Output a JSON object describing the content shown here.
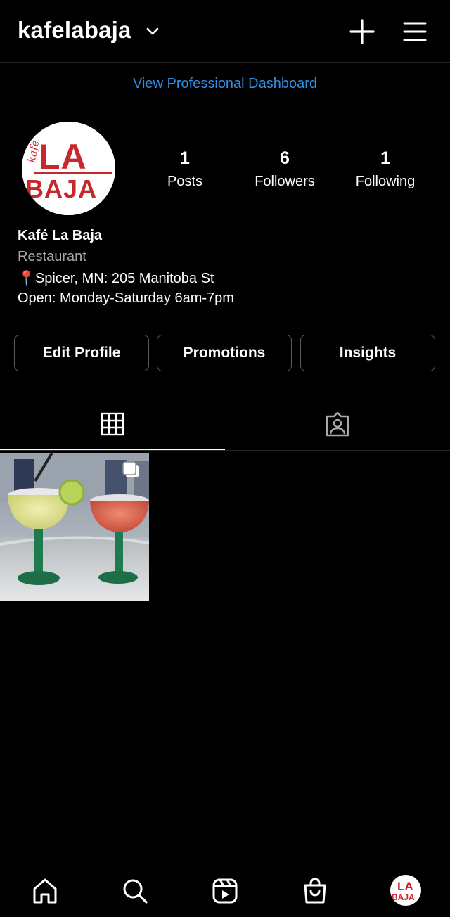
{
  "header": {
    "username": "kafelabaja",
    "dashboard_link": "View Professional Dashboard"
  },
  "profile": {
    "avatar_text_top": "LA",
    "avatar_text_bottom": "BAJA",
    "avatar_text_side": "kafe",
    "stats": [
      {
        "value": "1",
        "label": "Posts"
      },
      {
        "value": "6",
        "label": "Followers"
      },
      {
        "value": "1",
        "label": "Following"
      }
    ],
    "name": "Kafé La Baja",
    "category": "Restaurant",
    "location": "📍Spicer, MN: 205 Manitoba St",
    "hours": "Open: Monday-Saturday 6am-7pm"
  },
  "actions": {
    "edit_profile": "Edit Profile",
    "promotions": "Promotions",
    "insights": "Insights"
  },
  "tabs": [
    {
      "icon": "grid-icon",
      "active": true
    },
    {
      "icon": "tagged-person-icon",
      "active": false
    }
  ],
  "posts": [
    {
      "icon": "multiple-photos-icon",
      "subject": "two margarita glasses"
    }
  ],
  "bottom_nav": [
    {
      "icon": "home-icon"
    },
    {
      "icon": "search-icon"
    },
    {
      "icon": "reels-icon"
    },
    {
      "icon": "shop-icon"
    },
    {
      "icon": "profile-avatar"
    }
  ],
  "colors": {
    "background": "#000000",
    "link_blue": "#2d8fe3",
    "secondary_text": "#a8a8a8",
    "avatar_red": "#c8282c"
  }
}
